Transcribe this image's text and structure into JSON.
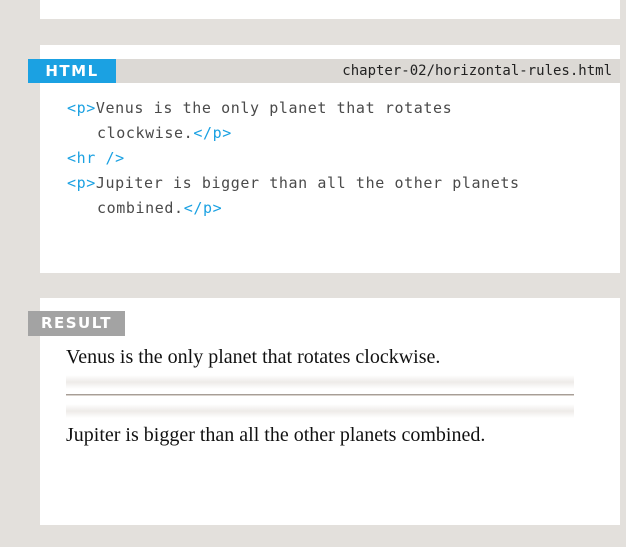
{
  "code_block": {
    "label": "HTML",
    "filename": "chapter-02/horizontal-rules.html",
    "lines": [
      {
        "open": "<p>",
        "text": "Venus is the only planet that rotates",
        "close": ""
      },
      {
        "open": "",
        "text": "clockwise.",
        "close": "</p>"
      },
      {
        "open": "<hr />",
        "text": "",
        "close": ""
      },
      {
        "open": "<p>",
        "text": "Jupiter is bigger than all the other planets",
        "close": ""
      },
      {
        "open": "",
        "text": "combined.",
        "close": "</p>"
      }
    ]
  },
  "result": {
    "label": "RESULT",
    "paragraph_1": "Venus is the only planet that rotates clockwise.",
    "paragraph_2": "Jupiter is bigger than all the other planets combined."
  },
  "colors": {
    "page_background": "#e3e0dc",
    "panel": "#ffffff",
    "html_label": "#1ba1e2",
    "result_label": "#a3a3a3",
    "code_tag": "#1ba1e2",
    "code_text": "#4a4a4a"
  }
}
